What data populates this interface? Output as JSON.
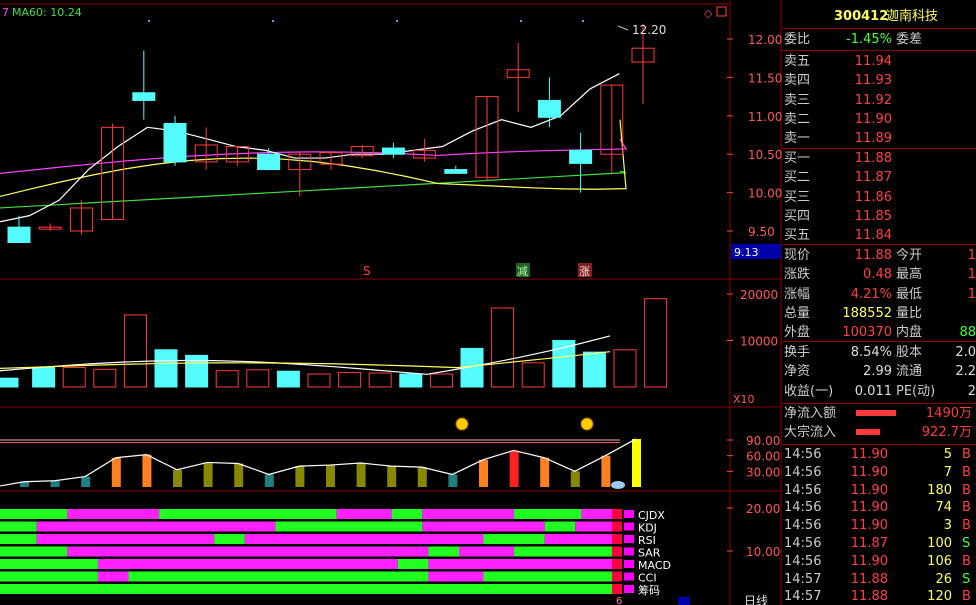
{
  "colors": {
    "up": "#ff3a3a",
    "down": "#54fcfc",
    "ma5": "#ffffff",
    "ma10": "#ffff60",
    "ma20": "#ff40ff",
    "ma60": "#40e040",
    "grid": "#8b0000",
    "axis": "#ff4040"
  },
  "chart": {
    "ma_label": "MA60: 10.24",
    "ma_prefix": "7",
    "price_axis": [
      "12.00",
      "11.50",
      "11.00",
      "10.50",
      "10.00",
      "9.50"
    ],
    "price_marker": "12.20",
    "price_low_label": "9.13",
    "signals": [
      "S",
      "减",
      "涨"
    ],
    "vol_axis": [
      "20000",
      "10000"
    ],
    "vol_unit": "X10",
    "flow_axis": [
      "90.00",
      "60.00",
      "30.00"
    ],
    "ind_axis": [
      "20.00",
      "10.00"
    ],
    "ind_labels": [
      "CJDX",
      "KDJ",
      "RSI",
      "SAR",
      "MACD",
      "CCI",
      "筹码"
    ],
    "tf_label": "日线",
    "extra_label": "6",
    "candles": [
      {
        "o": 9.55,
        "h": 9.7,
        "l": 9.35,
        "c": 9.35
      },
      {
        "o": 9.55,
        "h": 9.6,
        "l": 9.5,
        "c": 9.55
      },
      {
        "o": 9.5,
        "h": 9.9,
        "l": 9.45,
        "c": 9.8
      },
      {
        "o": 9.65,
        "h": 10.9,
        "l": 9.65,
        "c": 10.85
      },
      {
        "o": 11.3,
        "h": 11.85,
        "l": 10.95,
        "c": 11.2
      },
      {
        "o": 10.9,
        "h": 11.0,
        "l": 10.35,
        "c": 10.4
      },
      {
        "o": 10.4,
        "h": 10.85,
        "l": 10.3,
        "c": 10.62
      },
      {
        "o": 10.4,
        "h": 10.6,
        "l": 10.35,
        "c": 10.6
      },
      {
        "o": 10.5,
        "h": 10.58,
        "l": 10.3,
        "c": 10.3
      },
      {
        "o": 10.3,
        "h": 10.52,
        "l": 9.95,
        "c": 10.5
      },
      {
        "o": 10.37,
        "h": 10.52,
        "l": 10.3,
        "c": 10.52
      },
      {
        "o": 10.48,
        "h": 10.62,
        "l": 10.45,
        "c": 10.6
      },
      {
        "o": 10.58,
        "h": 10.65,
        "l": 10.45,
        "c": 10.5
      },
      {
        "o": 10.45,
        "h": 10.7,
        "l": 10.4,
        "c": 10.55
      },
      {
        "o": 10.3,
        "h": 10.35,
        "l": 10.25,
        "c": 10.25
      },
      {
        "o": 10.2,
        "h": 11.25,
        "l": 10.15,
        "c": 11.25
      },
      {
        "o": 11.5,
        "h": 11.95,
        "l": 11.05,
        "c": 11.6
      },
      {
        "o": 11.2,
        "h": 11.5,
        "l": 10.85,
        "c": 10.98
      },
      {
        "o": 10.55,
        "h": 10.78,
        "l": 10.0,
        "c": 10.38
      },
      {
        "o": 10.5,
        "h": 11.4,
        "l": 10.25,
        "c": 11.4
      },
      {
        "o": 11.7,
        "h": 12.2,
        "l": 11.15,
        "c": 11.88
      }
    ],
    "vol": [
      1900,
      4200,
      4200,
      3800,
      15500,
      8000,
      6800,
      3500,
      3700,
      3400,
      2800,
      3100,
      3000,
      2800,
      2800,
      8300,
      17000,
      5200,
      10000,
      7500,
      8000,
      19000
    ],
    "ma5_line": [
      9.62,
      9.7,
      9.9,
      10.3,
      10.6,
      10.85,
      10.8,
      10.7,
      10.6,
      10.55,
      10.45,
      10.45,
      10.5,
      10.5,
      10.55,
      10.6,
      10.8,
      10.95,
      10.85,
      11.0,
      11.35,
      11.55
    ],
    "flow": [
      10,
      12,
      20,
      56,
      62,
      33,
      47,
      45,
      24,
      40,
      42,
      46,
      40,
      38,
      24,
      52,
      70,
      56,
      30,
      60,
      92
    ],
    "chips": {
      "CJDX": [
        [
          0,
          0.11,
          "g"
        ],
        [
          0.11,
          0.26,
          "m"
        ],
        [
          0.26,
          0.55,
          "g"
        ],
        [
          0.55,
          0.64,
          "m"
        ],
        [
          0.64,
          0.69,
          "g"
        ],
        [
          0.69,
          0.84,
          "m"
        ],
        [
          0.84,
          0.95,
          "g"
        ],
        [
          0.95,
          1,
          "m"
        ]
      ],
      "KDJ": [
        [
          0,
          0.06,
          "g"
        ],
        [
          0.06,
          0.45,
          "m"
        ],
        [
          0.45,
          0.69,
          "g"
        ],
        [
          0.69,
          0.89,
          "m"
        ],
        [
          0.89,
          0.94,
          "g"
        ],
        [
          0.94,
          1,
          "m"
        ]
      ],
      "RSI": [
        [
          0,
          0.06,
          "g"
        ],
        [
          0.06,
          0.35,
          "m"
        ],
        [
          0.35,
          0.4,
          "g"
        ],
        [
          0.4,
          0.79,
          "m"
        ],
        [
          0.79,
          0.89,
          "g"
        ],
        [
          0.89,
          1,
          "m"
        ]
      ],
      "SAR": [
        [
          0,
          0.11,
          "g"
        ],
        [
          0.11,
          0.7,
          "m"
        ],
        [
          0.7,
          0.75,
          "g"
        ],
        [
          0.75,
          0.84,
          "m"
        ],
        [
          0.84,
          1,
          "g"
        ]
      ],
      "MACD": [
        [
          0,
          0.16,
          "g"
        ],
        [
          0.16,
          0.65,
          "m"
        ],
        [
          0.65,
          0.7,
          "g"
        ],
        [
          0.7,
          1,
          "m"
        ]
      ],
      "CCI": [
        [
          0,
          0.16,
          "g"
        ],
        [
          0.16,
          0.21,
          "m"
        ],
        [
          0.21,
          0.7,
          "g"
        ],
        [
          0.7,
          0.79,
          "m"
        ],
        [
          0.79,
          1,
          "g"
        ]
      ],
      "筹码": [
        [
          0,
          1,
          "g"
        ]
      ]
    }
  },
  "side": {
    "code": "300412",
    "name": "迦南科技",
    "weibi_label": "委比",
    "weibi_val": "-1.45%",
    "weicha_label": "委差",
    "asks": [
      {
        "l": "卖五",
        "p": "11.94"
      },
      {
        "l": "卖四",
        "p": "11.93"
      },
      {
        "l": "卖三",
        "p": "11.92"
      },
      {
        "l": "卖二",
        "p": "11.90"
      },
      {
        "l": "卖一",
        "p": "11.89"
      }
    ],
    "bids": [
      {
        "l": "买一",
        "p": "11.88"
      },
      {
        "l": "买二",
        "p": "11.87"
      },
      {
        "l": "买三",
        "p": "11.86"
      },
      {
        "l": "买四",
        "p": "11.85"
      },
      {
        "l": "买五",
        "p": "11.84"
      }
    ],
    "stats": [
      {
        "a": "现价",
        "av": "11.88",
        "b": "今开",
        "bv": "1"
      },
      {
        "a": "涨跌",
        "av": "0.48",
        "b": "最高",
        "bv": "1"
      },
      {
        "a": "涨幅",
        "av": "4.21%",
        "b": "最低",
        "bv": "1"
      },
      {
        "a": "总量",
        "av": "188552",
        "b": "量比",
        "bv": ""
      },
      {
        "a": "外盘",
        "av": "100370",
        "b": "内盘",
        "bv": "88"
      }
    ],
    "stats2": [
      {
        "a": "换手",
        "av": "8.54%",
        "b": "股本",
        "bv": "2.0"
      },
      {
        "a": "净资",
        "av": "2.99",
        "b": "流通",
        "bv": "2.2"
      },
      {
        "a": "收益(一)",
        "av": "0.011",
        "b": "PE(动)",
        "bv": "2"
      }
    ],
    "flow_in_label": "净流入额",
    "flow_in_val": "1490万",
    "block_label": "大宗流入",
    "block_val": "922.7万",
    "trades": [
      {
        "t": "14:56",
        "p": "11.90",
        "v": "5",
        "d": "B"
      },
      {
        "t": "14:56",
        "p": "11.90",
        "v": "7",
        "d": "B"
      },
      {
        "t": "14:56",
        "p": "11.90",
        "v": "180",
        "d": "B"
      },
      {
        "t": "14:56",
        "p": "11.90",
        "v": "74",
        "d": "B"
      },
      {
        "t": "14:56",
        "p": "11.90",
        "v": "3",
        "d": "B"
      },
      {
        "t": "14:56",
        "p": "11.87",
        "v": "100",
        "d": "S"
      },
      {
        "t": "14:56",
        "p": "11.90",
        "v": "106",
        "d": "B"
      },
      {
        "t": "14:57",
        "p": "11.88",
        "v": "26",
        "d": "S"
      },
      {
        "t": "14:57",
        "p": "11.88",
        "v": "120",
        "d": "B"
      }
    ]
  }
}
